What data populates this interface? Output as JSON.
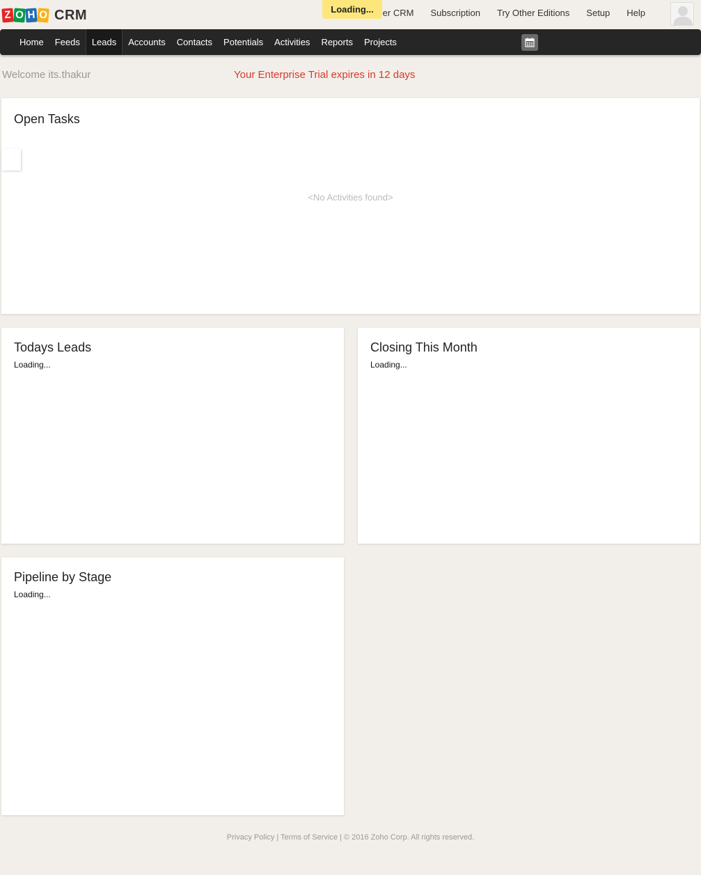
{
  "app": {
    "logo_letters": [
      "Z",
      "O",
      "H",
      "O"
    ],
    "logo_product": "CRM",
    "loading_indicator": "Loading...",
    "top_links": [
      "...ther CRM",
      "Subscription",
      "Try Other Editions",
      "Setup",
      "Help"
    ]
  },
  "nav": {
    "items": [
      "Home",
      "Feeds",
      "Leads",
      "Accounts",
      "Contacts",
      "Potentials",
      "Activities",
      "Reports",
      "Projects"
    ],
    "active": "Leads",
    "calendar_icon": "calendar-icon"
  },
  "welcome": {
    "text": "Welcome its.thakur",
    "trial_notice": "Your Enterprise Trial expires in 12 days"
  },
  "panels": {
    "open_tasks": {
      "title": "Open Tasks",
      "empty_text": "<No Activities found>"
    },
    "todays_leads": {
      "title": "Todays Leads",
      "status": "Loading..."
    },
    "closing_this_month": {
      "title": "Closing This Month",
      "status": "Loading..."
    },
    "pipeline_by_stage": {
      "title": "Pipeline by Stage",
      "status": "Loading..."
    }
  },
  "footer": {
    "privacy": "Privacy Policy",
    "sep1": " | ",
    "terms": "Terms of Service",
    "copyright": " | © 2016 Zoho Corp. All rights reserved."
  },
  "colors": {
    "background": "#f2efea",
    "navbar": "#262626",
    "trial_text": "#d63a2e",
    "loading_pill": "#fde77c"
  }
}
